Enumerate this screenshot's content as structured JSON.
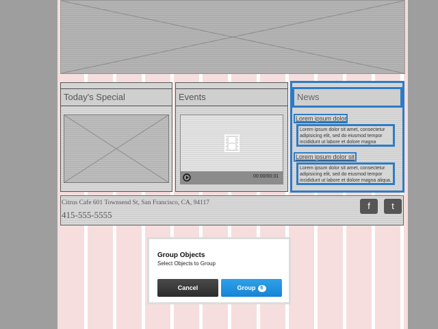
{
  "panels": {
    "special": {
      "title": "Today's Special"
    },
    "events": {
      "title": "Events",
      "video_time": "00:00/00:31"
    },
    "news": {
      "title": "News",
      "items": [
        {
          "title": "Lorem ipsum dolor",
          "body": "Lorem ipsum dolor sit amet, consectetur adipisicing elit, sed do eiusmod tempor incididunt ut labore et dolore magna"
        },
        {
          "title": "Lorem ipsum dolor sit",
          "body": "Lorem ipsum dolor sit amet, consectetur adipisicing elit, sed do eiusmod tempor incididunt ut labore et dolore magna aliqua."
        }
      ]
    }
  },
  "footer": {
    "address": "Citrus Cafe 601 Townsend St, San Francisco, CA, 94117",
    "phone": "415-555-5555",
    "social": {
      "facebook": "f",
      "twitter": "t"
    }
  },
  "dialog": {
    "title": "Group Objects",
    "subtitle": "Select Objects to Group",
    "cancel_label": "Cancel",
    "group_label": "Group",
    "group_count": "6"
  },
  "icons": {
    "hero": "image-placeholder-icon",
    "special": "image-placeholder-icon",
    "video": "film-icon",
    "play": "play-icon"
  },
  "colors": {
    "selection": "#2c7bc8",
    "primary_button": "#1684d4",
    "cancel_button": "#333333"
  }
}
